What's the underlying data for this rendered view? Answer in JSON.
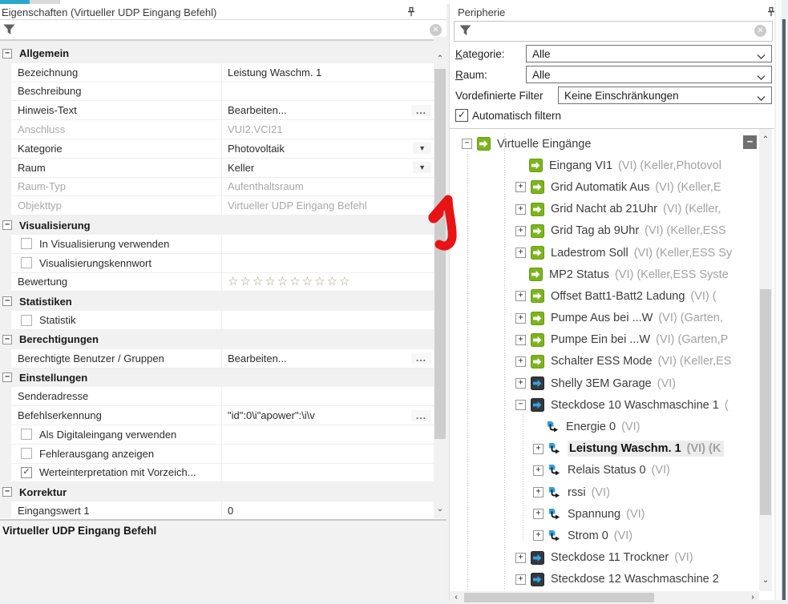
{
  "colors": {
    "tab_accent": "#2aa7d0",
    "icon_green": "#7cb41e",
    "icon_green_border": "#689c12",
    "icon_dark": "#33383d",
    "icon_dark_border": "#22262a",
    "icon_blue": "#35a1dc",
    "selection_bg": "#ececec",
    "annotation_red": "#e81313"
  },
  "left_panel": {
    "title": "Eigenschaften (Virtueller UDP Eingang Befehl)",
    "status_text": "Virtueller UDP Eingang Befehl",
    "rows": [
      {
        "type": "section",
        "label": "Allgemein"
      },
      {
        "type": "text",
        "label": "Bezeichnung",
        "value": "Leistung Waschm. 1"
      },
      {
        "type": "text",
        "label": "Beschreibung",
        "value": ""
      },
      {
        "type": "text",
        "label": "Hinweis-Text",
        "value": "Bearbeiten...",
        "button": "ellipsis"
      },
      {
        "type": "text",
        "label": "Anschluss",
        "value": "VUI2.VCI21",
        "disabled": true
      },
      {
        "type": "text",
        "label": "Kategorie",
        "value": "Photovoltaik",
        "button": "dropdown"
      },
      {
        "type": "text",
        "label": "Raum",
        "value": "Keller",
        "button": "dropdown"
      },
      {
        "type": "text",
        "label": "Raum-Typ",
        "value": "Aufenthaltsraum",
        "disabled": true
      },
      {
        "type": "text",
        "label": "Objekttyp",
        "value": "Virtueller UDP Eingang Befehl",
        "disabled": true
      },
      {
        "type": "section",
        "label": "Visualisierung"
      },
      {
        "type": "checkbox",
        "label": "In Visualisierung verwenden",
        "checked": false
      },
      {
        "type": "checkbox",
        "label": "Visualisierungskennwort",
        "checked": false
      },
      {
        "type": "stars",
        "label": "Bewertung",
        "count": 10
      },
      {
        "type": "section",
        "label": "Statistiken"
      },
      {
        "type": "checkbox",
        "label": "Statistik",
        "checked": false
      },
      {
        "type": "section",
        "label": "Berechtigungen"
      },
      {
        "type": "text",
        "label": "Berechtigte Benutzer / Gruppen",
        "value": "Bearbeiten...",
        "button": "ellipsis"
      },
      {
        "type": "section",
        "label": "Einstellungen"
      },
      {
        "type": "text",
        "label": "Senderadresse",
        "value": ""
      },
      {
        "type": "text",
        "label": "Befehlserkennung",
        "value": "\"id\":0\\i\"apower\":\\i\\v",
        "button": "ellipsis"
      },
      {
        "type": "checkbox",
        "label": "Als Digitaleingang verwenden",
        "checked": false
      },
      {
        "type": "checkbox",
        "label": "Fehlerausgang anzeigen",
        "checked": false
      },
      {
        "type": "checkbox",
        "label": "Werteinterpretation mit Vorzeich...",
        "checked": true
      },
      {
        "type": "section",
        "label": "Korrektur"
      },
      {
        "type": "text",
        "label": "Eingangswert 1",
        "value": "0"
      }
    ]
  },
  "right_panel": {
    "title": "Peripherie",
    "filters": {
      "kategorie_initial": "K",
      "kategorie_rest": "ategorie:",
      "kategorie_value": "Alle",
      "raum_initial": "R",
      "raum_rest": "aum:",
      "raum_value": "Alle",
      "predef_label": "Vordefinierte Filter",
      "predef_value": "Keine Einschränkungen",
      "auto_filter_label": "Automatisch filtern",
      "auto_filter_checked": "✓"
    },
    "tree": [
      {
        "level": 0,
        "expander": "minus",
        "icon": "green-arrow",
        "name": "Virtuelle Eingänge",
        "suffix": ""
      },
      {
        "level": 1,
        "expander": "none",
        "icon": "green-arrow",
        "name": "Eingang VI1",
        "suffix": "(VI) (Keller,Photovol"
      },
      {
        "level": 1,
        "expander": "plus",
        "icon": "green-arrow",
        "name": "Grid Automatik Aus",
        "suffix": "(VI) (Keller,E"
      },
      {
        "level": 1,
        "expander": "plus",
        "icon": "green-arrow",
        "name": "Grid Nacht ab 21Uhr",
        "suffix": "(VI) (Keller,"
      },
      {
        "level": 1,
        "expander": "plus",
        "icon": "green-arrow",
        "name": "Grid Tag ab 9Uhr",
        "suffix": "(VI) (Keller,ESS"
      },
      {
        "level": 1,
        "expander": "plus",
        "icon": "green-arrow",
        "name": "Ladestrom Soll",
        "suffix": "(VI) (Keller,ESS Sy"
      },
      {
        "level": 1,
        "expander": "none",
        "icon": "green-arrow",
        "name": "MP2 Status",
        "suffix": "(VI) (Keller,ESS Syste"
      },
      {
        "level": 1,
        "expander": "plus",
        "icon": "green-arrow",
        "name": "Offset Batt1-Batt2 Ladung",
        "suffix": "(VI) ("
      },
      {
        "level": 1,
        "expander": "plus",
        "icon": "green-arrow",
        "name": "Pumpe Aus bei ...W",
        "suffix": "(VI) (Garten,"
      },
      {
        "level": 1,
        "expander": "plus",
        "icon": "green-arrow",
        "name": "Pumpe Ein bei ...W",
        "suffix": "(VI) (Garten,P"
      },
      {
        "level": 1,
        "expander": "plus",
        "icon": "green-arrow",
        "name": "Schalter ESS Mode",
        "suffix": "(VI) (Keller,ES"
      },
      {
        "level": 1,
        "expander": "plus",
        "icon": "dark-arrow",
        "name": "Shelly 3EM Garage",
        "suffix": "(VI)"
      },
      {
        "level": 1,
        "expander": "minus",
        "icon": "dark-arrow",
        "name": "Steckdose 10 Waschmaschine 1",
        "suffix": "("
      },
      {
        "level": 2,
        "expander": "none",
        "icon": "sub",
        "name": "Energie 0",
        "suffix": "(VI)"
      },
      {
        "level": 2,
        "expander": "plus",
        "icon": "sub",
        "name": "Leistung Waschm. 1",
        "suffix": "(VI) (K",
        "selected": true
      },
      {
        "level": 2,
        "expander": "plus",
        "icon": "sub",
        "name": "Relais Status 0",
        "suffix": "(VI)"
      },
      {
        "level": 2,
        "expander": "plus",
        "icon": "sub",
        "name": "rssi",
        "suffix": "(VI)"
      },
      {
        "level": 2,
        "expander": "plus",
        "icon": "sub",
        "name": "Spannung",
        "suffix": "(VI)"
      },
      {
        "level": 2,
        "expander": "plus",
        "icon": "sub",
        "name": "Strom 0",
        "suffix": "(VI)"
      },
      {
        "level": 1,
        "expander": "plus",
        "icon": "dark-arrow",
        "name": "Steckdose 11 Trockner",
        "suffix": "(VI)"
      },
      {
        "level": 1,
        "expander": "plus",
        "icon": "dark-arrow",
        "name": "Steckdose 12 Waschmaschine 2",
        "suffix": ""
      }
    ]
  },
  "annotations": {
    "step_number": "1"
  }
}
